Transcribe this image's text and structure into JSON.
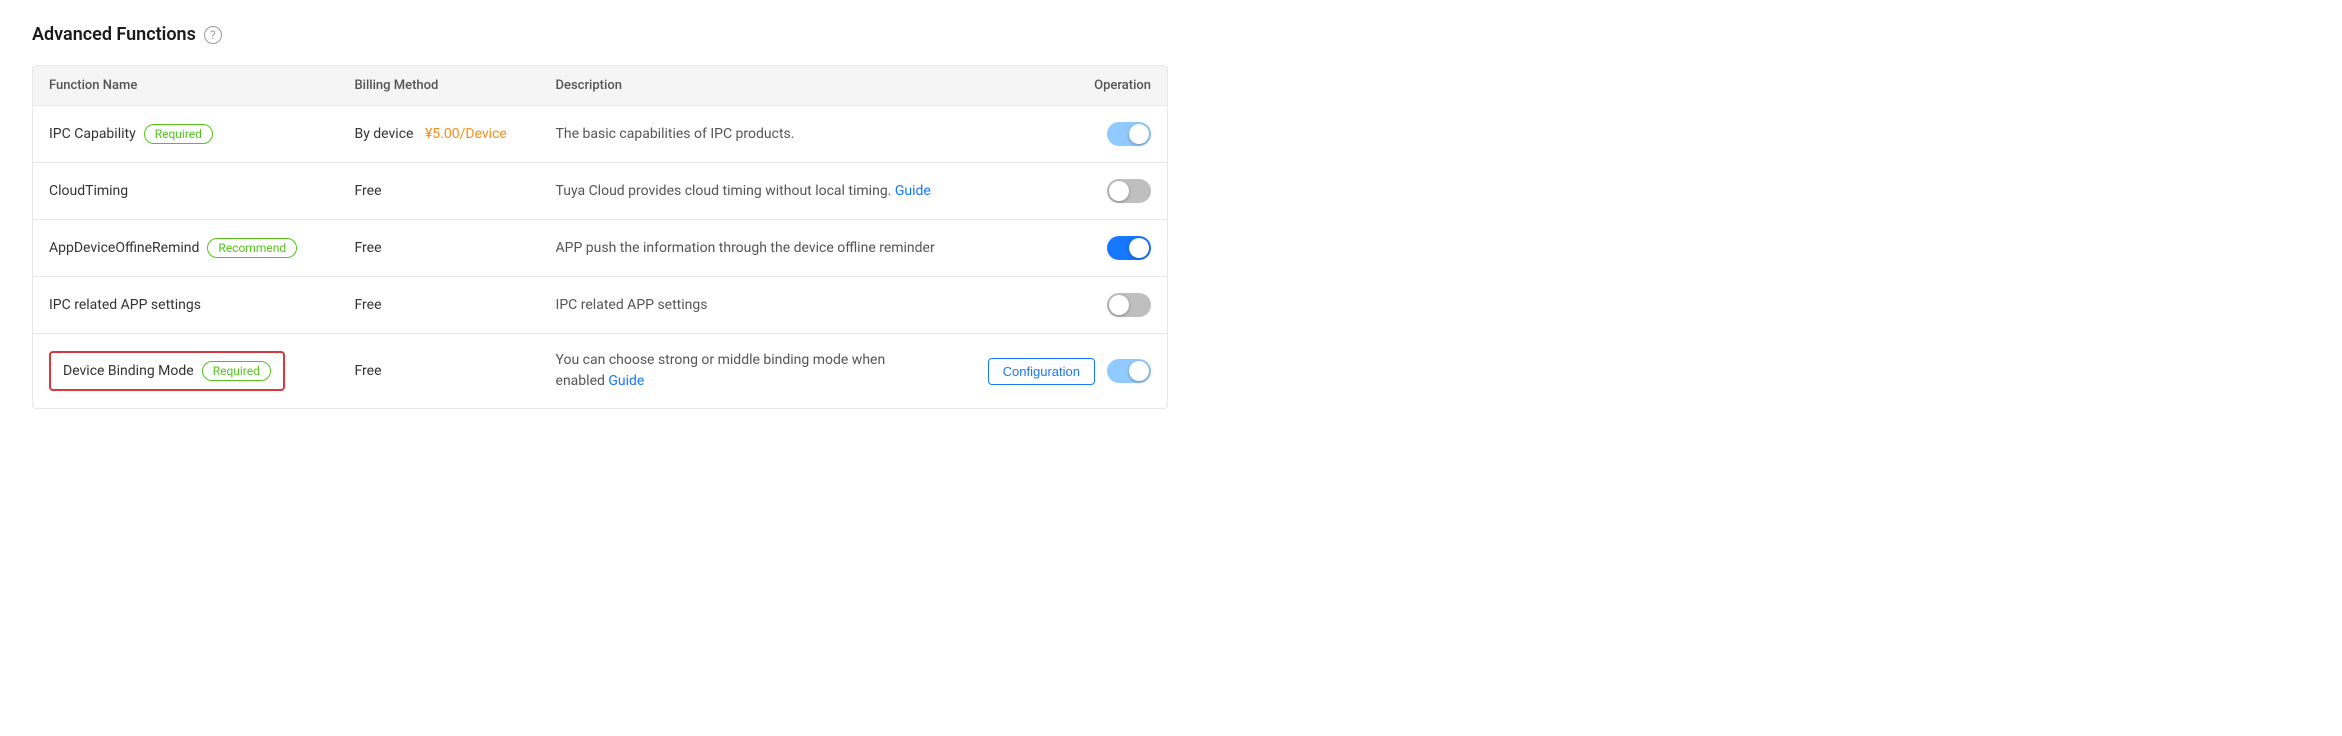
{
  "section": {
    "title": "Advanced Functions",
    "help_icon_label": "?"
  },
  "table": {
    "columns": [
      {
        "key": "function_name",
        "label": "Function Name"
      },
      {
        "key": "billing_method",
        "label": "Billing Method"
      },
      {
        "key": "description",
        "label": "Description"
      },
      {
        "key": "operation",
        "label": "Operation"
      }
    ],
    "rows": [
      {
        "id": "ipc-capability",
        "function_name": "IPC Capability",
        "badge": "Required",
        "badge_type": "required",
        "billing_method": "By device",
        "price": "¥5.00/Device",
        "description": "The basic capabilities of IPC products.",
        "toggle_state": "partial",
        "has_config": false,
        "highlighted": false
      },
      {
        "id": "cloud-timing",
        "function_name": "CloudTiming",
        "badge": null,
        "badge_type": null,
        "billing_method": "Free",
        "price": null,
        "description": "Tuya Cloud provides cloud timing without local timing.",
        "description_link": "Guide",
        "toggle_state": "off",
        "has_config": false,
        "highlighted": false
      },
      {
        "id": "app-device-offline-remind",
        "function_name": "AppDeviceOffineRemind",
        "badge": "Recommend",
        "badge_type": "recommend",
        "billing_method": "Free",
        "price": null,
        "description": "APP push the information through the device offline reminder",
        "toggle_state": "on",
        "has_config": false,
        "highlighted": false
      },
      {
        "id": "ipc-related-app-settings",
        "function_name": "IPC related APP settings",
        "badge": null,
        "badge_type": null,
        "billing_method": "Free",
        "price": null,
        "description": "IPC related APP settings",
        "toggle_state": "off",
        "has_config": false,
        "highlighted": false
      },
      {
        "id": "device-binding-mode",
        "function_name": "Device Binding Mode",
        "badge": "Required",
        "badge_type": "required",
        "billing_method": "Free",
        "price": null,
        "description": "You can choose strong or middle binding mode when enabled",
        "description_link": "Guide",
        "toggle_state": "partial",
        "has_config": true,
        "config_label": "Configuration",
        "highlighted": true
      }
    ]
  },
  "colors": {
    "required_badge": "#52c41a",
    "recommend_badge": "#52c41a",
    "price_color": "#fa8c16",
    "guide_link_color": "#1677ff",
    "config_button_color": "#1677ff",
    "highlight_border": "#d9363e",
    "toggle_on": "#1677ff",
    "toggle_off": "#bfbfbf",
    "toggle_partial": "#91caff"
  }
}
